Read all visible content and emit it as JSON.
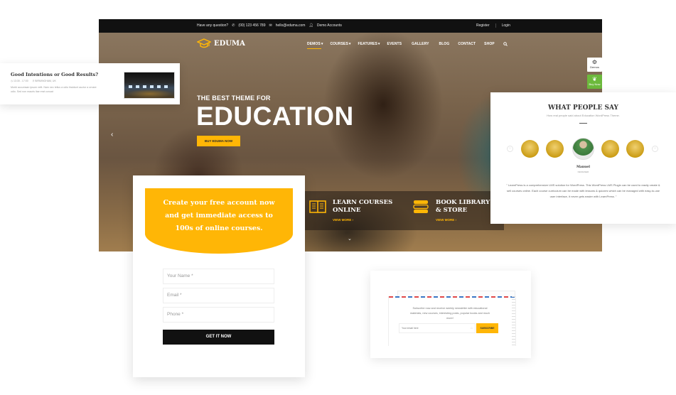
{
  "hero": {
    "topbar": {
      "question": "Have any question?",
      "phone": "(00) 123 456 789",
      "email": "hello@eduma.com",
      "demo_accounts": "Demo Accounts",
      "register": "Register",
      "login": "Login"
    },
    "logo": "EDUMA",
    "nav": [
      {
        "label": "DEMOS",
        "has_caret": true,
        "active": true
      },
      {
        "label": "COURSES",
        "has_caret": true
      },
      {
        "label": "FEATURES",
        "has_caret": true
      },
      {
        "label": "EVENTS"
      },
      {
        "label": "GALLERY"
      },
      {
        "label": "BLOG"
      },
      {
        "label": "CONTACT"
      },
      {
        "label": "SHOP"
      }
    ],
    "subtitle": "THE BEST THEME FOR",
    "title": "EDUCATION",
    "cta": "BUY EDUMA NOW",
    "features": [
      {
        "title_line1": "LEARN COURSES",
        "title_line2": "ONLINE",
        "link": "VIEW MORE ›",
        "icon": "open-book-icon"
      },
      {
        "title_line1": "BOOK LIBRARY",
        "title_line2": "& STORE",
        "link": "VIEW MORE ›",
        "icon": "book-stack-icon"
      }
    ],
    "side_tools": {
      "demos": "Demos",
      "buy_now": "Buy Now"
    }
  },
  "event_card": {
    "title": "Good Intentions or Good Results?",
    "time": "13:30 - 17:00",
    "location": "BIRMINGHAM, UK",
    "description": "Morbi accumsan ipsum velit. Nam nec tellus a odio tincidunt auctor a ornare odio. Sed non mauris itae erat conuat"
  },
  "testimonials": {
    "title": "WHAT PEOPLE SAY",
    "subtitle": "How real people said about Education WordPress Theme.",
    "active_name": "Manuel",
    "active_role": "DESIGNER",
    "quote": "\" LearnPress is a comprehensive LMS solution for WordPress. This WordPress LMS Plugin can be used to easily create & sell courses online. Each course curriculum can be made with lessons & quizzes which can be managed with easy-to-use user interface, it never gets easier with LearnPress. \"",
    "avatar_count": 5,
    "active_index": 2
  },
  "signup": {
    "headline": "Create your free account now and get immediate access to 100s of online courses.",
    "name_placeholder": "Your Name *",
    "email_placeholder": "Email *",
    "phone_placeholder": "Phone *",
    "submit": "GET IT NOW"
  },
  "newsletter": {
    "text": "Subscribe now and receive weekly newsletter with educational materials, new courses, interesting posts, popular books and much more!",
    "email_placeholder": "Your email here",
    "submit": "SUBSCRIBE"
  },
  "colors": {
    "accent": "#ffb606",
    "dark": "#111111",
    "buy_green": "#6cb93c"
  }
}
